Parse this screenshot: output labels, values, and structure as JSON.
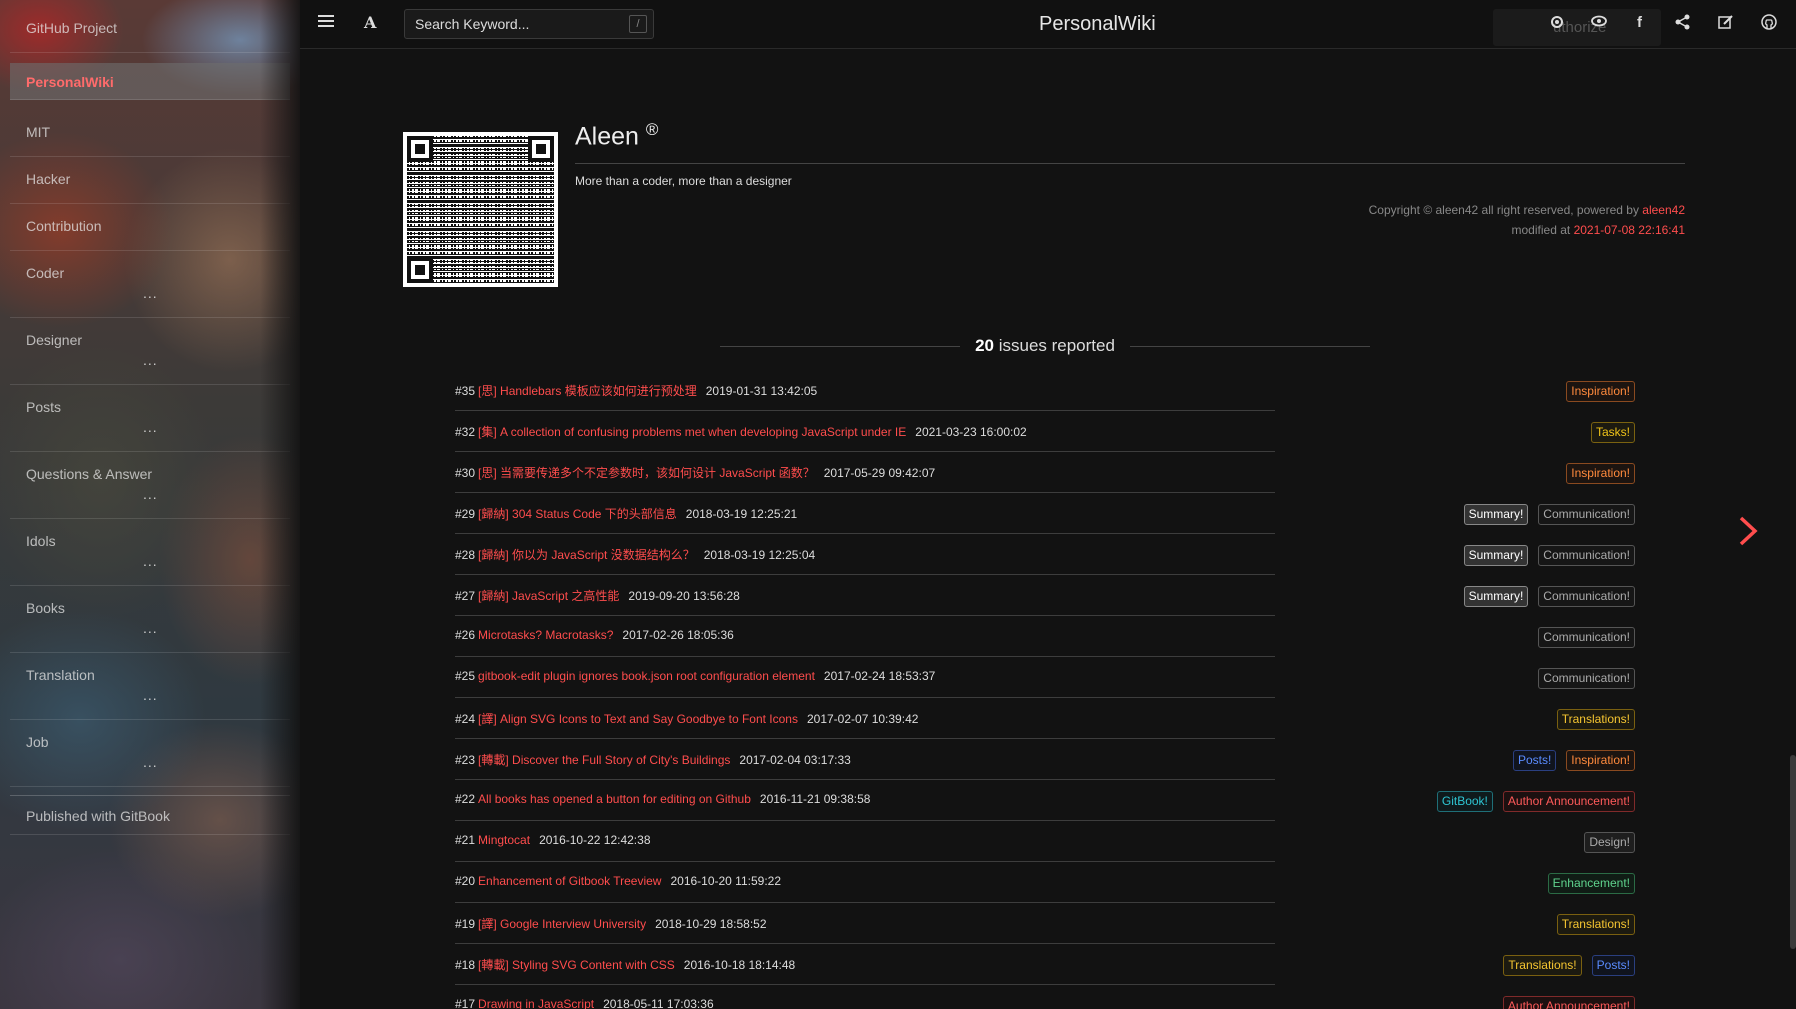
{
  "sidebar": {
    "items": [
      {
        "label": "GitHub Project",
        "dots": ""
      },
      {
        "label": "PersonalWiki",
        "dots": ""
      },
      {
        "label": "MIT",
        "dots": ""
      },
      {
        "label": "Hacker",
        "dots": ""
      },
      {
        "label": "Contribution",
        "dots": ""
      },
      {
        "label": "Coder",
        "dots": "..."
      },
      {
        "label": "Designer",
        "dots": "..."
      },
      {
        "label": "Posts",
        "dots": "..."
      },
      {
        "label": "Questions & Answer",
        "dots": "..."
      },
      {
        "label": "Idols",
        "dots": "..."
      },
      {
        "label": "Books",
        "dots": "..."
      },
      {
        "label": "Translation",
        "dots": "..."
      },
      {
        "label": "Job",
        "dots": "..."
      }
    ],
    "footer": "Published with GitBook"
  },
  "header": {
    "search_placeholder": "Search Keyword...",
    "search_shortcut": "/",
    "title": "PersonalWiki",
    "auth_ghost": "uthorize"
  },
  "profile": {
    "name": "Aleen",
    "registered": "®",
    "tagline": "More than a coder, more than a designer",
    "copyright_prefix": "Copyright © aleen42 all right reserved, powered by ",
    "copyright_author": "aleen42",
    "modified_prefix": "modified at ",
    "modified_at": "2021-07-08 22:16:41"
  },
  "issues_summary": {
    "count": "20",
    "suffix": " issues reported"
  },
  "issues": [
    {
      "num": "#35",
      "title": "[思] Handlebars 模板应该如何进行预处理",
      "date": "2019-01-31 13:42:05",
      "labels": [
        {
          "text": "Inspiration!",
          "kind": "inspiration"
        }
      ]
    },
    {
      "num": "#32",
      "title": "[集] A collection of confusing problems met when developing JavaScript under IE",
      "date": "2021-03-23 16:00:02",
      "labels": [
        {
          "text": "Tasks!",
          "kind": "tasks"
        }
      ]
    },
    {
      "num": "#30",
      "title": "[思] 当需要传递多个不定参数时，该如何设计 JavaScript 函数？",
      "date": "2017-05-29 09:42:07",
      "labels": [
        {
          "text": "Inspiration!",
          "kind": "inspiration"
        }
      ]
    },
    {
      "num": "#29",
      "title": "[歸納] 304 Status Code 下的头部信息",
      "date": "2018-03-19 12:25:21",
      "labels": [
        {
          "text": "Summary!",
          "kind": "summary"
        },
        {
          "text": "Communication!",
          "kind": "communication"
        }
      ]
    },
    {
      "num": "#28",
      "title": "[歸納] 你以为 JavaScript 没数据结构么？",
      "date": "2018-03-19 12:25:04",
      "labels": [
        {
          "text": "Summary!",
          "kind": "summary"
        },
        {
          "text": "Communication!",
          "kind": "communication"
        }
      ]
    },
    {
      "num": "#27",
      "title": "[歸納] JavaScript 之高性能",
      "date": "2019-09-20 13:56:28",
      "labels": [
        {
          "text": "Summary!",
          "kind": "summary"
        },
        {
          "text": "Communication!",
          "kind": "communication"
        }
      ]
    },
    {
      "num": "#26",
      "title": "Microtasks? Macrotasks?",
      "date": "2017-02-26 18:05:36",
      "labels": [
        {
          "text": "Communication!",
          "kind": "communication"
        }
      ]
    },
    {
      "num": "#25",
      "title": "gitbook-edit plugin ignores book.json root configuration element",
      "date": "2017-02-24 18:53:37",
      "labels": [
        {
          "text": "Communication!",
          "kind": "communication"
        }
      ]
    },
    {
      "num": "#24",
      "title": "[譯] Align SVG Icons to Text and Say Goodbye to Font Icons",
      "date": "2017-02-07 10:39:42",
      "labels": [
        {
          "text": "Translations!",
          "kind": "translations"
        }
      ]
    },
    {
      "num": "#23",
      "title": "[轉載] Discover the Full Story of City's Buildings",
      "date": "2017-02-04 03:17:33",
      "labels": [
        {
          "text": "Posts!",
          "kind": "posts"
        },
        {
          "text": "Inspiration!",
          "kind": "inspiration"
        }
      ]
    },
    {
      "num": "#22",
      "title": "All books has opened a button for editing on Github",
      "date": "2016-11-21 09:38:58",
      "labels": [
        {
          "text": "GitBook!",
          "kind": "gitbook"
        },
        {
          "text": "Author Announcement!",
          "kind": "author"
        }
      ]
    },
    {
      "num": "#21",
      "title": "Mingtocat",
      "date": "2016-10-22 12:42:38",
      "labels": [
        {
          "text": "Design!",
          "kind": "design"
        }
      ]
    },
    {
      "num": "#20",
      "title": "Enhancement of Gitbook Treeview",
      "date": "2016-10-20 11:59:22",
      "labels": [
        {
          "text": "Enhancement!",
          "kind": "enhancement"
        }
      ]
    },
    {
      "num": "#19",
      "title": "[譯] Google Interview University",
      "date": "2018-10-29 18:58:52",
      "labels": [
        {
          "text": "Translations!",
          "kind": "translations"
        }
      ]
    },
    {
      "num": "#18",
      "title": "[轉載] Styling SVG Content with CSS",
      "date": "2016-10-18 18:14:48",
      "labels": [
        {
          "text": "Translations!",
          "kind": "translations"
        },
        {
          "text": "Posts!",
          "kind": "posts"
        }
      ]
    },
    {
      "num": "#17",
      "title": "Drawing in JavaScript",
      "date": "2018-05-11 17:03:36",
      "labels": [
        {
          "text": "Author Announcement!",
          "kind": "author"
        }
      ]
    }
  ],
  "icons": {
    "menu": "hamburger-icon",
    "font": "font-settings-icon",
    "settings": "gear-icon",
    "theme": "eye-icon",
    "facebook": "facebook-icon",
    "share": "share-icon",
    "edit": "edit-icon",
    "github": "github-icon",
    "next": "chevron-right-icon"
  },
  "colors": {
    "accent": "#ff4d4d",
    "background": "#121212"
  }
}
